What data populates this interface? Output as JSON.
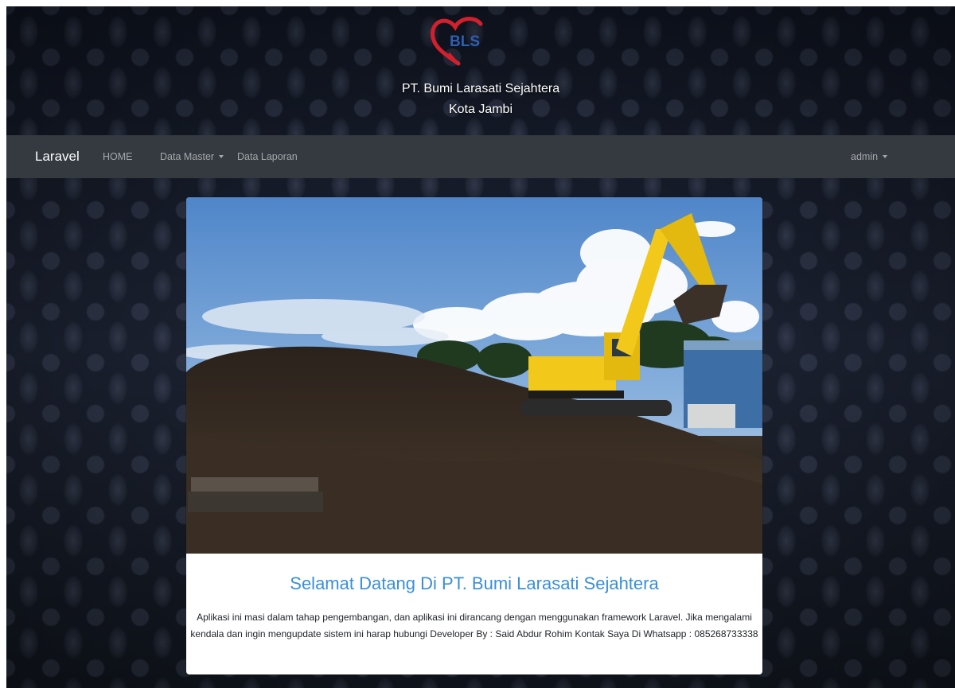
{
  "header": {
    "logo_text": "BLS",
    "company_name": "PT. Bumi Larasati Sejahtera",
    "city": "Kota Jambi"
  },
  "navbar": {
    "brand": "Laravel",
    "items": [
      {
        "label": "HOME"
      },
      {
        "label": "Data Master",
        "dropdown": true
      },
      {
        "label": "Data Laporan"
      }
    ],
    "user": {
      "label": "admin",
      "dropdown": true
    }
  },
  "card": {
    "title": "Selamat Datang Di PT. Bumi Larasati Sejahtera",
    "body": "Aplikasi ini masi dalam tahap pengembangan, dan aplikasi ini dirancang dengan menggunakan framework Laravel. Jika mengalami kendala dan ingin mengupdate sistem ini harap hubungi Developer By : Said Abdur Rohim Kontak Saya Di Whatsapp : 085268733338"
  },
  "colors": {
    "navbar_bg": "#343a40",
    "title_blue": "#3a8fd9",
    "logo_red": "#d4202c",
    "logo_blue": "#2f5fb0",
    "excavator_yellow": "#f2c81a"
  }
}
